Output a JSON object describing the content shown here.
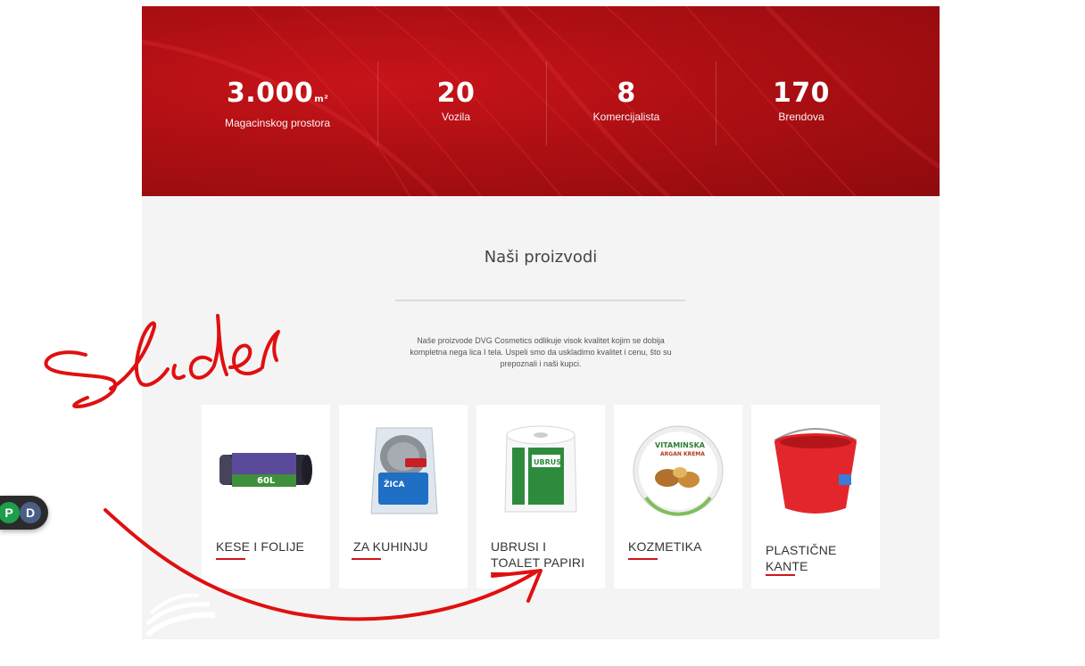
{
  "stats": [
    {
      "value": "3.000",
      "unit": "m²",
      "label": "Magacinskog prostora"
    },
    {
      "value": "20",
      "unit": "",
      "label": "Vozila"
    },
    {
      "value": "8",
      "unit": "",
      "label": "Komercijalista"
    },
    {
      "value": "170",
      "unit": "",
      "label": "Brendova"
    }
  ],
  "products": {
    "title": "Naši proizvodi",
    "description": "Naše proizvode DVG Cosmetics odlikuje visok kvalitet kojim se dobija kompletna nega lica I tela. Uspeli smo da uskladimo kvalitet i cenu, što su prepoznali i naši kupci.",
    "categories": [
      {
        "name": "KESE I FOLIJE",
        "icon": "garbage-bag-roll-icon"
      },
      {
        "name": "ZA KUHINJU",
        "icon": "steel-scrubber-icon"
      },
      {
        "name": "UBRUSI I TOALET PAPIRI",
        "icon": "paper-towel-roll-icon"
      },
      {
        "name": "KOZMETIKA",
        "icon": "cosmetic-cream-jar-icon"
      },
      {
        "name": "PLASTIČNE KANTE",
        "icon": "red-bucket-icon"
      }
    ]
  },
  "widget": {
    "left_letter": "P",
    "right_letter": "D"
  },
  "annotation": {
    "handwritten_text": "slider"
  },
  "colors": {
    "accent": "#d3141a",
    "banner": "#ad0f13",
    "section_bg": "#f4f4f4"
  }
}
